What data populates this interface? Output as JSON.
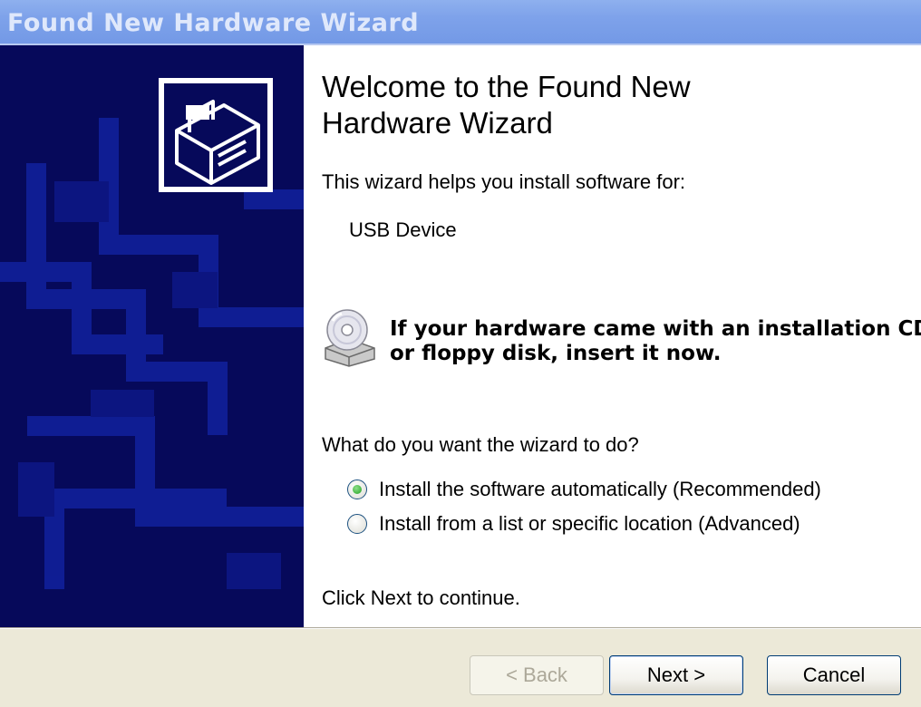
{
  "window": {
    "title": "Found New Hardware Wizard"
  },
  "main": {
    "heading_line1": "Welcome to the Found New",
    "heading_line2": "Hardware Wizard",
    "intro": "This wizard helps you install software for:",
    "device_name": "USB Device",
    "cd_prompt_line1": "If your hardware came with an installation CD",
    "cd_prompt_line2": "or floppy disk, insert it now.",
    "question": "What do you want the wizard to do?",
    "options": [
      {
        "label": "Install the software automatically (Recommended)",
        "checked": true
      },
      {
        "label": "Install from a list or specific location (Advanced)",
        "checked": false
      }
    ],
    "continue_hint": "Click Next to continue."
  },
  "buttons": {
    "back": "< Back",
    "next": "Next >",
    "cancel": "Cancel"
  },
  "icons": {
    "hardware": "hardware-box-icon",
    "cd": "cd-drive-icon"
  },
  "colors": {
    "sidebar": "#06095a",
    "titlebar": "#7ea2ea",
    "radio_selected": "#21a121"
  }
}
